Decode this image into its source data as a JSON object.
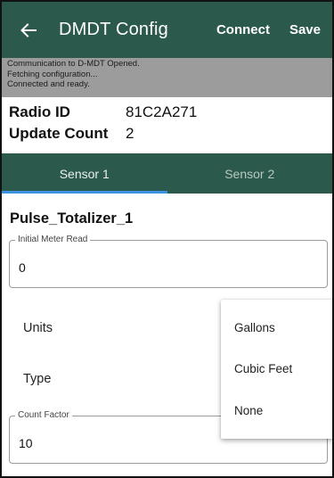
{
  "appbar": {
    "title": "DMDT Config",
    "connect_label": "Connect",
    "save_label": "Save",
    "back_icon": "arrow-left-icon",
    "background": "#2b5a4c"
  },
  "log": {
    "lines": [
      "Communication to D-MDT Opened.",
      "Fetching configuration...",
      "Connected and ready."
    ]
  },
  "info": {
    "radio_id_label": "Radio ID",
    "radio_id_value": "81C2A271",
    "update_count_label": "Update Count",
    "update_count_value": "2"
  },
  "tabs": [
    {
      "label": "Sensor 1",
      "active": true
    },
    {
      "label": "Sensor 2",
      "active": false
    }
  ],
  "sensor": {
    "name": "Pulse_Totalizer_1",
    "initial_meter_read": {
      "label": "Initial Meter Read",
      "value": "0"
    },
    "units_label": "Units",
    "type_label": "Type",
    "count_factor": {
      "label": "Count Factor",
      "value": "10"
    }
  },
  "units_menu": {
    "options": [
      "Gallons",
      "Cubic Feet",
      "None"
    ]
  }
}
